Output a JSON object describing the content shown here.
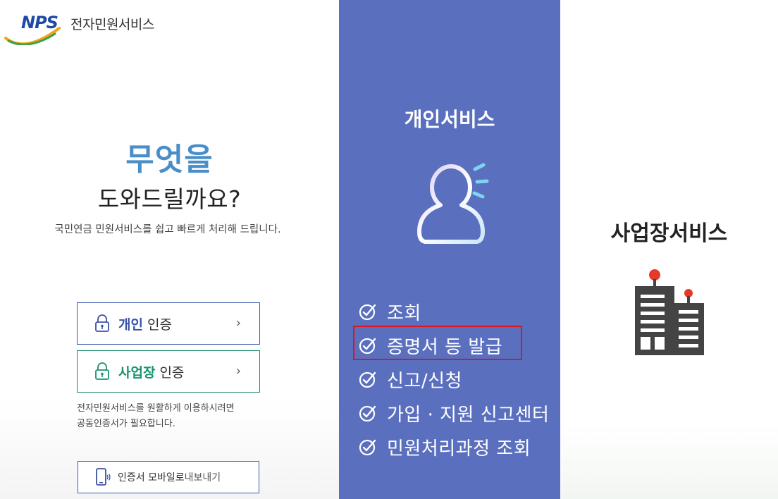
{
  "header": {
    "logo_mark": "NPS",
    "logo_text": "전자민원서비스"
  },
  "hero": {
    "title_line1": "무엇을",
    "title_line2": "도와드릴까요?",
    "subtitle": "국민연금 민원서비스를 쉽고 빠르게 처리해 드립니다."
  },
  "auth": {
    "personal": {
      "strong": "개인",
      "normal": "인증"
    },
    "business": {
      "strong": "사업장",
      "normal": "인증"
    },
    "chevron": "›",
    "notice_line1": "전자민원서비스를 원활하게 이용하시려면",
    "notice_line2": "공동인증서가 필요합니다.",
    "mobile": {
      "strong": "인증서 모바일로",
      "normal": " 내보내기"
    }
  },
  "personal_service": {
    "title": "개인서비스",
    "items": [
      {
        "label": "조회"
      },
      {
        "label": "증명서 등 발급"
      },
      {
        "label": "신고/신청"
      },
      {
        "label": "가입 · 지원 신고센터"
      },
      {
        "label": "민원처리과정 조회"
      }
    ]
  },
  "business_service": {
    "title": "사업장서비스"
  },
  "colors": {
    "accent_blue": "#5b6fbf",
    "hero_blue": "#4a8ec8",
    "personal_auth": "#3b52a8",
    "business_auth": "#17936e",
    "highlight_red": "#e0141b"
  },
  "icons": [
    "logo-swoosh-icon",
    "lock-icon",
    "mobile-phone-icon",
    "person-icon",
    "check-circle-icon",
    "building-icon"
  ]
}
